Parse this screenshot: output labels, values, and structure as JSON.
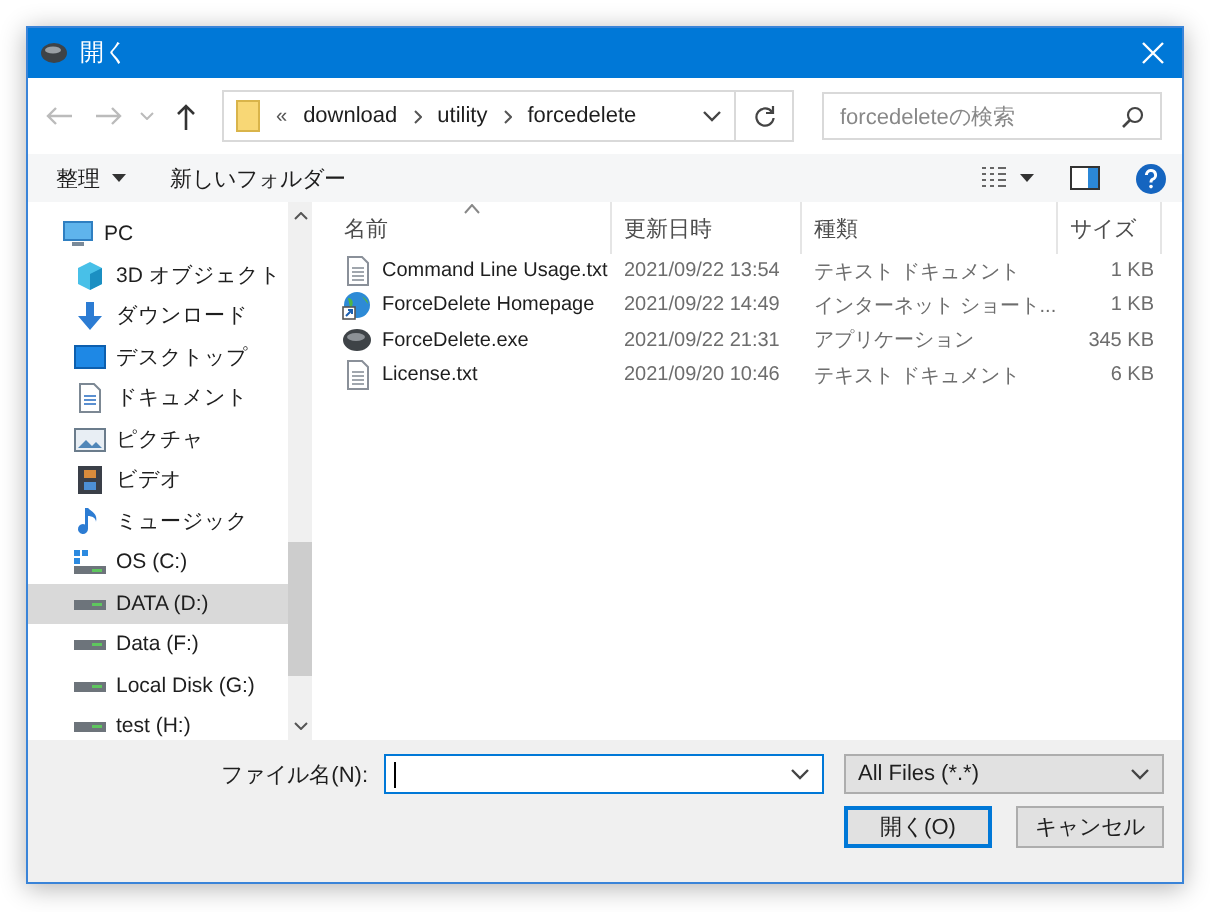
{
  "window": {
    "title": "開く"
  },
  "address": {
    "overflow": "«",
    "crumbs": [
      "download",
      "utility",
      "forcedelete"
    ]
  },
  "search": {
    "placeholder": "forcedeleteの検索"
  },
  "toolbar": {
    "organize": "整理",
    "new_folder": "新しいフォルダー"
  },
  "sidebar": {
    "items": [
      {
        "label": "PC",
        "kind": "pc",
        "selected": false,
        "children": [
          {
            "label": "3D オブジェクト",
            "kind": "objects3d",
            "selected": false
          },
          {
            "label": "ダウンロード",
            "kind": "downloads",
            "selected": false
          },
          {
            "label": "デスクトップ",
            "kind": "desktop",
            "selected": false
          },
          {
            "label": "ドキュメント",
            "kind": "documents",
            "selected": false
          },
          {
            "label": "ピクチャ",
            "kind": "pictures",
            "selected": false
          },
          {
            "label": "ビデオ",
            "kind": "videos",
            "selected": false
          },
          {
            "label": "ミュージック",
            "kind": "music",
            "selected": false
          },
          {
            "label": "OS (C:)",
            "kind": "system-drive",
            "selected": false
          },
          {
            "label": "DATA (D:)",
            "kind": "drive",
            "selected": true
          },
          {
            "label": "Data (F:)",
            "kind": "drive",
            "selected": false
          },
          {
            "label": "Local Disk (G:)",
            "kind": "drive",
            "selected": false
          },
          {
            "label": "test (H:)",
            "kind": "drive",
            "selected": false
          }
        ]
      }
    ]
  },
  "file_list": {
    "columns": [
      {
        "label": "名前",
        "sorted": true
      },
      {
        "label": "更新日時",
        "sorted": false
      },
      {
        "label": "種類",
        "sorted": false
      },
      {
        "label": "サイズ",
        "sorted": false
      }
    ],
    "rows": [
      {
        "name": "Command Line Usage.txt",
        "modified": "2021/09/22 13:54",
        "type": "テキスト ドキュメント",
        "size": "1 KB",
        "kind": "text"
      },
      {
        "name": "ForceDelete Homepage",
        "modified": "2021/09/22 14:49",
        "type": "インターネット ショート...",
        "size": "1 KB",
        "kind": "link"
      },
      {
        "name": "ForceDelete.exe",
        "modified": "2021/09/22 21:31",
        "type": "アプリケーション",
        "size": "345 KB",
        "kind": "app"
      },
      {
        "name": "License.txt",
        "modified": "2021/09/20 10:46",
        "type": "テキスト ドキュメント",
        "size": "6 KB",
        "kind": "text"
      }
    ]
  },
  "footer": {
    "file_name_label": "ファイル名(N):",
    "file_type": "All Files (*.*)",
    "buttons": [
      {
        "label": "開く(O)",
        "default": true
      },
      {
        "label": "キャンセル",
        "default": false
      }
    ]
  }
}
